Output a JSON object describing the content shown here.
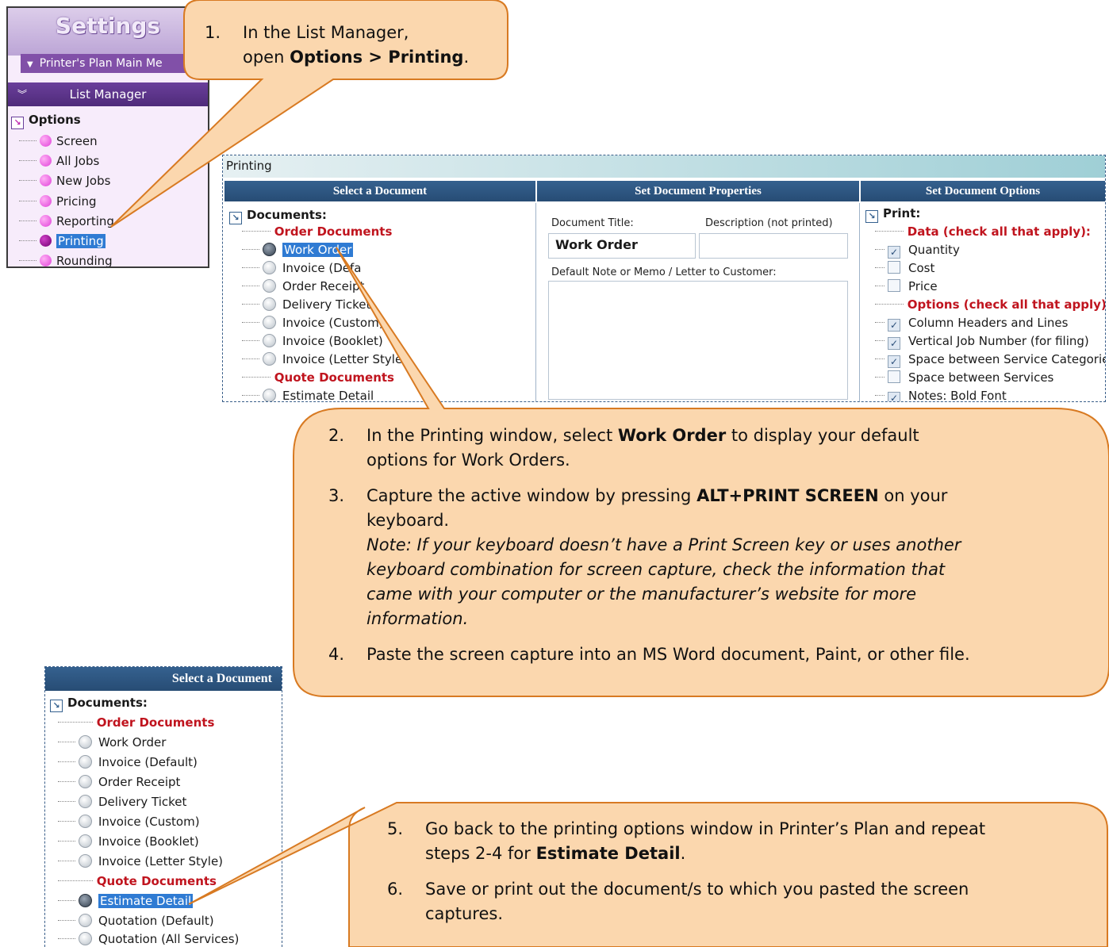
{
  "settings": {
    "title": "Settings",
    "main_menu": "Printer's Plan Main Me",
    "list_manager": "List Manager",
    "options_root": "Options",
    "items": [
      "Screen",
      "All Jobs",
      "New Jobs",
      "Pricing",
      "Reporting",
      "Printing",
      "Rounding"
    ],
    "selected_item": "Printing"
  },
  "callout1": {
    "num": "1.",
    "line1": "In the List Manager,",
    "line2_pre": "open ",
    "line2_bold": "Options > Printing",
    "line2_post": "."
  },
  "printing_window": {
    "title": "Printing",
    "col1_header": "Select a Document",
    "col2_header": "Set Document Properties",
    "col3_header": "Set Document Options",
    "documents_root": "Documents:",
    "order_docs_heading": "Order Documents",
    "order_docs": [
      "Work Order",
      "Invoice (Defa",
      "Order Receipt",
      "Delivery Ticket",
      "Invoice (Custom)",
      "Invoice (Booklet)",
      "Invoice (Letter Style)"
    ],
    "quote_docs_heading": "Quote Documents",
    "quote_docs": [
      "Estimate Detail"
    ],
    "doc_title_label": "Document Title:",
    "description_label": "Description (not printed)",
    "doc_title_value": "Work Order",
    "description_value": "",
    "note_label": "Default Note or Memo / Letter to Customer:",
    "print_root": "Print:",
    "data_heading": "Data (check all that apply):",
    "data_items": [
      {
        "label": "Quantity",
        "checked": true
      },
      {
        "label": "Cost",
        "checked": false
      },
      {
        "label": "Price",
        "checked": false
      }
    ],
    "options_heading": "Options (check all that apply):",
    "option_items": [
      {
        "label": "Column Headers and Lines",
        "checked": true
      },
      {
        "label": "Vertical Job Number (for filing)",
        "checked": true
      },
      {
        "label": "Space between Service Categories",
        "checked": true
      },
      {
        "label": "Space between Services",
        "checked": false
      },
      {
        "label": "Notes: Bold Font",
        "checked": true
      }
    ]
  },
  "callout2": {
    "step2_num": "2.",
    "step2_pre": "In the Printing window, select ",
    "step2_bold": "Work Order",
    "step2_post": " to display your default",
    "step2_line2": "options for Work Orders.",
    "step3_num": "3.",
    "step3_pre": "Capture the active window by pressing ",
    "step3_bold": "ALT+PRINT SCREEN",
    "step3_post": " on your",
    "step3_line2": "keyboard.",
    "note_l1": "Note: If your keyboard doesn’t have a Print Screen key or uses another",
    "note_l2": "keyboard combination for screen capture, check the information that",
    "note_l3": "came with your computer or the manufacturer’s website for more",
    "note_l4": "information.",
    "step4_num": "4.",
    "step4_text": "Paste the screen capture into an MS Word document, Paint, or other file."
  },
  "select_panel": {
    "header": "Select a Document",
    "documents_root": "Documents:",
    "order_docs_heading": "Order Documents",
    "order_docs": [
      "Work Order",
      "Invoice (Default)",
      "Order Receipt",
      "Delivery Ticket",
      "Invoice (Custom)",
      "Invoice (Booklet)",
      "Invoice (Letter Style)"
    ],
    "quote_docs_heading": "Quote Documents",
    "quote_docs": [
      "Estimate Detail",
      "Quotation (Default)",
      "Quotation (All Services)"
    ],
    "selected": "Estimate Detail"
  },
  "callout3": {
    "step5_num": "5.",
    "step5_line1": "Go back to the printing options window in Printer’s Plan and repeat",
    "step5_pre": "steps 2-4 for ",
    "step5_bold": "Estimate Detail",
    "step5_post": ".",
    "step6_num": "6.",
    "step6_line1": "Save or print out the document/s to which you pasted the screen",
    "step6_line2": "captures."
  },
  "colors": {
    "callout_fill": "#fbd7ae",
    "callout_stroke": "#d87a22",
    "header_blue": "#2f5783",
    "heading_red": "#c0141e",
    "purple": "#6a3f9b"
  }
}
